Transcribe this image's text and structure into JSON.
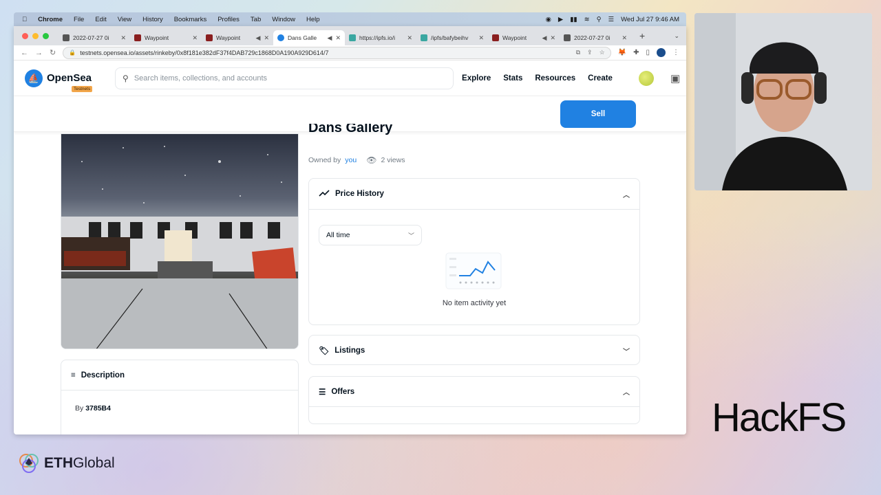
{
  "menubar": {
    "app": "Chrome",
    "menus": [
      "File",
      "Edit",
      "View",
      "History",
      "Bookmarks",
      "Profiles",
      "Tab",
      "Window",
      "Help"
    ],
    "datetime": "Wed Jul 27  9:46 AM"
  },
  "tabs": [
    {
      "label": "2022-07-27 0i",
      "favicon_color": "#555555",
      "active": false
    },
    {
      "label": "Waypoint",
      "favicon_color": "#8a1f1f",
      "active": false
    },
    {
      "label": "Waypoint",
      "favicon_color": "#8a1f1f",
      "active": false
    },
    {
      "label": "Dans Galle",
      "favicon_color": "#2081e2",
      "active": true
    },
    {
      "label": "https://ipfs.io/i",
      "favicon_color": "#3aa7a1",
      "active": false
    },
    {
      "label": "/ipfs/bafybeihv",
      "favicon_color": "#3aa7a1",
      "active": false
    },
    {
      "label": "Waypoint",
      "favicon_color": "#8a1f1f",
      "active": false
    },
    {
      "label": "2022-07-27 0i",
      "favicon_color": "#555555",
      "active": false
    }
  ],
  "address": {
    "url": "testnets.opensea.io/assets/rinkeby/0x8f181e382dF37f4DAB729c1868D0A190A929D614/7"
  },
  "opensea": {
    "brand": "OpenSea",
    "badge": "Testnets",
    "search_placeholder": "Search items, collections, and accounts",
    "nav": [
      "Explore",
      "Stats",
      "Resources",
      "Create"
    ],
    "sell_label": "Sell",
    "title": "Dans Gallery",
    "owned_prefix": "Owned by",
    "owner": "you",
    "views": "2 views",
    "price_history": {
      "title": "Price History",
      "range": "All time",
      "empty": "No item activity yet"
    },
    "listings_title": "Listings",
    "offers_title": "Offers",
    "description": {
      "title": "Description",
      "by_prefix": "By",
      "creator": "3785B4"
    }
  },
  "overlay": {
    "event": "HackFS",
    "sponsor_a": "ETH",
    "sponsor_b": "Global"
  },
  "colors": {
    "accent": "#2081e2",
    "text": "#04111d",
    "badge": "#f2a64a"
  }
}
